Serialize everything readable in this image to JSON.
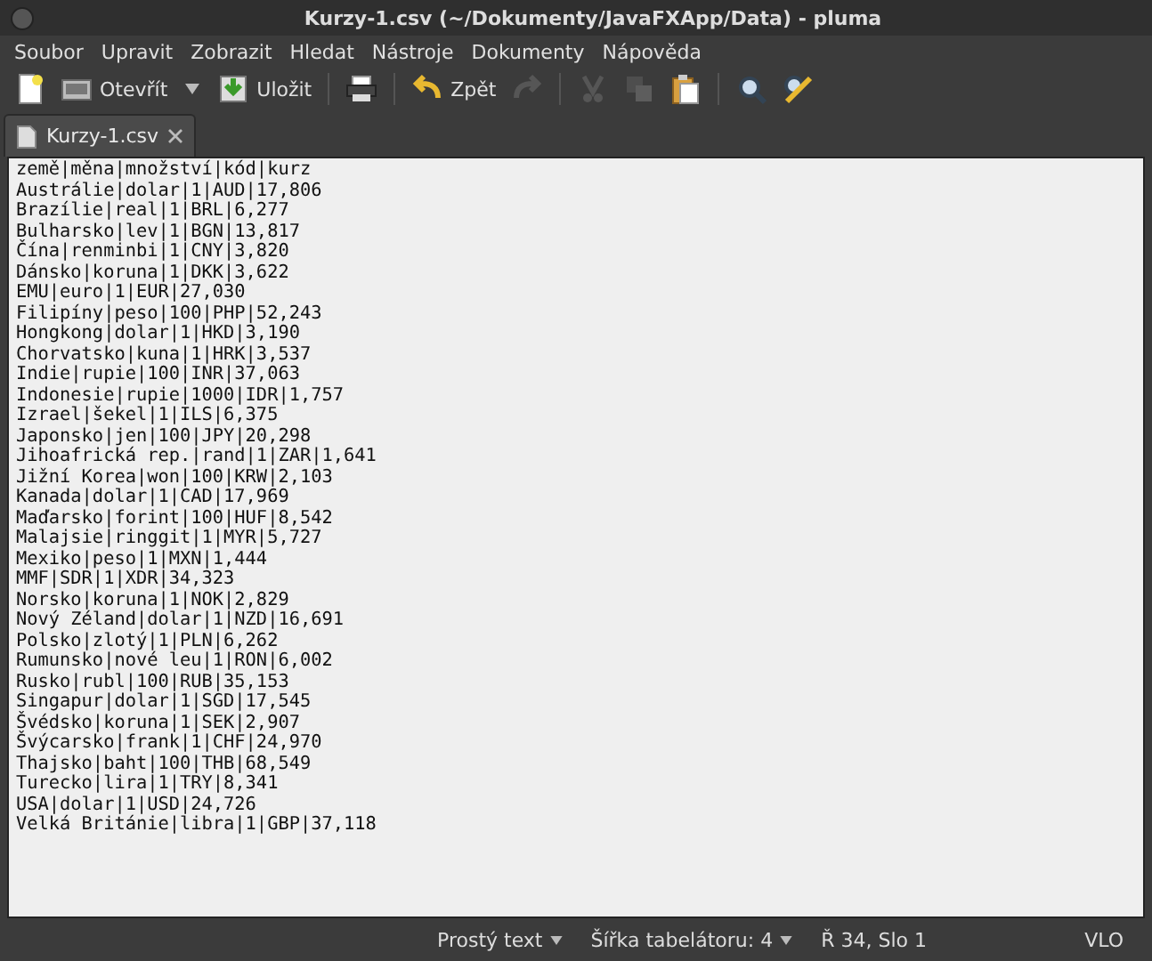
{
  "window": {
    "title": "Kurzy-1.csv (~/Dokumenty/JavaFXApp/Data) - pluma"
  },
  "menu": [
    "Soubor",
    "Upravit",
    "Zobrazit",
    "Hledat",
    "Nástroje",
    "Dokumenty",
    "Nápověda"
  ],
  "toolbar": [
    {
      "disabled": false
    },
    {
      "label": "Otevřít",
      "disabled": false
    },
    {
      "label": "Uložit",
      "disabled": false
    },
    {
      "disabled": false
    },
    {
      "label": "Zpět",
      "disabled": false
    },
    {
      "disabled": true
    },
    {
      "disabled": true
    },
    {
      "disabled": true
    },
    {
      "disabled": false
    },
    {
      "disabled": false
    },
    {
      "disabled": false
    }
  ],
  "tabs": [
    {
      "label": "Kurzy-1.csv",
      "selected": true
    }
  ],
  "editor": {
    "lines": [
      "země|měna|množství|kód|kurz",
      "Austrálie|dolar|1|AUD|17,806",
      "Brazílie|real|1|BRL|6,277",
      "Bulharsko|lev|1|BGN|13,817",
      "Čína|renminbi|1|CNY|3,820",
      "Dánsko|koruna|1|DKK|3,622",
      "EMU|euro|1|EUR|27,030",
      "Filipíny|peso|100|PHP|52,243",
      "Hongkong|dolar|1|HKD|3,190",
      "Chorvatsko|kuna|1|HRK|3,537",
      "Indie|rupie|100|INR|37,063",
      "Indonesie|rupie|1000|IDR|1,757",
      "Izrael|šekel|1|ILS|6,375",
      "Japonsko|jen|100|JPY|20,298",
      "Jihoafrická rep.|rand|1|ZAR|1,641",
      "Jižní Korea|won|100|KRW|2,103",
      "Kanada|dolar|1|CAD|17,969",
      "Maďarsko|forint|100|HUF|8,542",
      "Malajsie|ringgit|1|MYR|5,727",
      "Mexiko|peso|1|MXN|1,444",
      "MMF|SDR|1|XDR|34,323",
      "Norsko|koruna|1|NOK|2,829",
      "Nový Zéland|dolar|1|NZD|16,691",
      "Polsko|zlotý|1|PLN|6,262",
      "Rumunsko|nové leu|1|RON|6,002",
      "Rusko|rubl|100|RUB|35,153",
      "Singapur|dolar|1|SGD|17,545",
      "Švédsko|koruna|1|SEK|2,907",
      "Švýcarsko|frank|1|CHF|24,970",
      "Thajsko|baht|100|THB|68,549",
      "Turecko|lira|1|TRY|8,341",
      "USA|dolar|1|USD|24,726",
      "Velká Británie|libra|1|GBP|37,118"
    ]
  },
  "status_bar": {
    "syntax": "Prostý text",
    "tab_width": "Šířka tabelátoru:",
    "tab_width_value": "4",
    "position": "Ř 34, Slo 1",
    "mode": "VLO"
  }
}
